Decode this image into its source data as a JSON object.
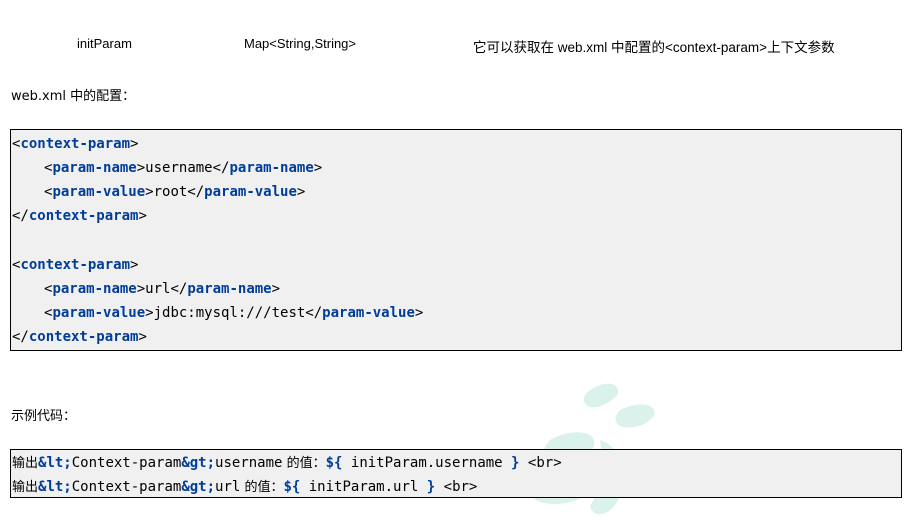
{
  "table_row": {
    "name": "initParam",
    "type": "Map<String,String>",
    "description": "它可以获取在 web.xml 中配置的<context-param>上下文参数"
  },
  "config_label": "web.xml 中的配置：",
  "config_code": {
    "block1": {
      "open_tag": "context-param",
      "name_tag": "param-name",
      "name_value": "username",
      "value_tag": "param-value",
      "value_value": "root"
    },
    "block2": {
      "open_tag": "context-param",
      "name_tag": "param-name",
      "name_value": "url",
      "value_tag": "param-value",
      "value_value": "jdbc:mysql:///test"
    }
  },
  "example_label": "示例代码：",
  "example_code": {
    "line1": {
      "prefix": "输出",
      "lt": "&lt;",
      "middle": "Context-param",
      "gt": "&gt;",
      "field": "username",
      "suffix": " 的值：",
      "expr_open": "${",
      "expr": " initParam.username ",
      "expr_close": "}",
      "br": "<br>"
    },
    "line2": {
      "prefix": "输出",
      "lt": "&lt;",
      "middle": "Context-param",
      "gt": "&gt;",
      "field": "url",
      "suffix": " 的值：",
      "expr_open": "${",
      "expr": " initParam.url ",
      "expr_close": "}",
      "br": "<br>"
    }
  }
}
